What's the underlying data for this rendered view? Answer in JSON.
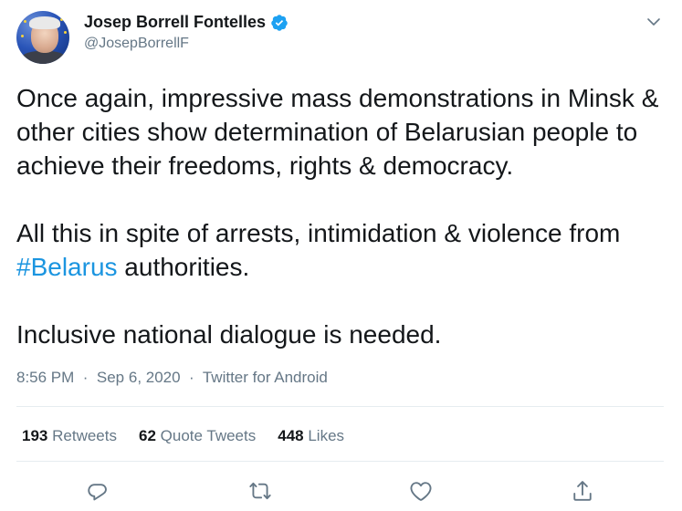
{
  "author": {
    "display_name": "Josep Borrell Fontelles",
    "handle": "@JosepBorrellF",
    "verified": true
  },
  "tweet": {
    "line1": "Once again, impressive mass demonstrations in Minsk & other cities show determination of Belarusian people to achieve their freedoms, rights & democracy.",
    "line2_before": "All this in spite of arrests, intimidation & violence from ",
    "line2_hashtag": "#Belarus",
    "line2_after": " authorities.",
    "line3": "Inclusive national dialogue is needed."
  },
  "meta": {
    "time": "8:56 PM",
    "date": "Sep 6, 2020",
    "source": "Twitter for Android",
    "separator": "·"
  },
  "stats": {
    "retweets_count": "193",
    "retweets_label": "Retweets",
    "quotes_count": "62",
    "quotes_label": "Quote Tweets",
    "likes_count": "448",
    "likes_label": "Likes"
  },
  "colors": {
    "text": "#14171a",
    "secondary": "#657786",
    "link": "#1b95e0",
    "verified": "#1da1f2",
    "divider": "#e6ecf0"
  },
  "icons": {
    "menu": "chevron-down-icon",
    "reply": "reply-icon",
    "retweet": "retweet-icon",
    "like": "heart-icon",
    "share": "share-icon"
  }
}
